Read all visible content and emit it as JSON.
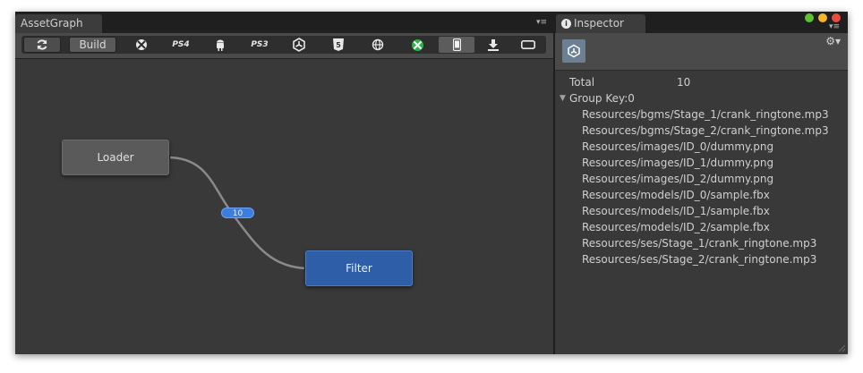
{
  "asset_graph": {
    "tab_title": "AssetGraph",
    "tab_menu": "▾≡",
    "toolbar": {
      "build_label": "Build",
      "platforms": [
        {
          "name": "refresh",
          "label": "⟳"
        },
        {
          "name": "xbox",
          "label": "⨂"
        },
        {
          "name": "ps4",
          "label": "PS4"
        },
        {
          "name": "android",
          "label": "⬙"
        },
        {
          "name": "ps3",
          "label": "PS3"
        },
        {
          "name": "unity",
          "label": "✲"
        },
        {
          "name": "html5",
          "label": "5"
        },
        {
          "name": "web",
          "label": "⊕"
        },
        {
          "name": "xbox-one",
          "label": "⨂"
        },
        {
          "name": "ios",
          "label": "▯"
        },
        {
          "name": "standalone",
          "label": "⤓"
        },
        {
          "name": "tv",
          "label": "▭"
        }
      ],
      "active_platform": "ios"
    },
    "nodes": {
      "loader_label": "Loader",
      "filter_label": "Filter"
    },
    "connection_count": "10",
    "colors": {
      "filter_node": "#2e5ea8",
      "badge": "#3d7de0",
      "xbox_one_green": "#2cb34a"
    }
  },
  "inspector": {
    "tab_title": "Inspector",
    "tab_menu": "▾≡",
    "total_label": "Total",
    "total_value": "10",
    "group_label": "Group Key:0",
    "files": [
      "Resources/bgms/Stage_1/crank_ringtone.mp3",
      "Resources/bgms/Stage_2/crank_ringtone.mp3",
      "Resources/images/ID_0/dummy.png",
      "Resources/images/ID_1/dummy.png",
      "Resources/images/ID_2/dummy.png",
      "Resources/models/ID_0/sample.fbx",
      "Resources/models/ID_1/sample.fbx",
      "Resources/models/ID_2/sample.fbx",
      "Resources/ses/Stage_1/crank_ringtone.mp3",
      "Resources/ses/Stage_2/crank_ringtone.mp3"
    ],
    "window_light_colors": [
      "#5fc235",
      "#f5b52f",
      "#e84c3d"
    ]
  }
}
